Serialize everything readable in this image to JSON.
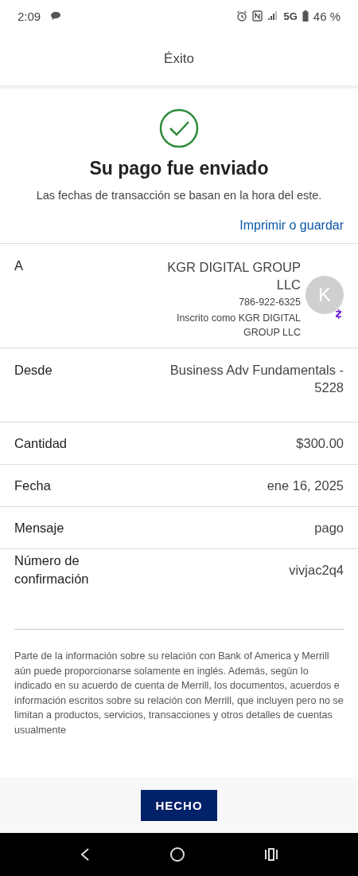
{
  "status_bar": {
    "time": "2:09",
    "network": "5G",
    "battery": "46 %"
  },
  "header": {
    "title": "Éxito"
  },
  "confirmation": {
    "title": "Su pago fue enviado",
    "subtitle": "Las fechas de transacción se basan en la hora del este.",
    "print_link": "Imprimir o guardar"
  },
  "recipient": {
    "label": "A",
    "name": "KGR DIGITAL GROUP LLC",
    "phone": "786-922-6325",
    "enrolled": "Inscrito como KGR DIGITAL GROUP LLC",
    "avatar_initial": "K"
  },
  "details": [
    {
      "label": "Desde",
      "value": "Business Adv Fundamentals - 5228"
    },
    {
      "label": "Cantidad",
      "value": "$300.00"
    },
    {
      "label": "Fecha",
      "value": "ene 16, 2025"
    },
    {
      "label": "Mensaje",
      "value": "pago"
    },
    {
      "label": "Número de confirmación",
      "value": "vivjac2q4"
    }
  ],
  "disclaimer": "Parte de la información sobre su relación con Bank of America y Merrill aún puede proporcionarse solamente en inglés. Además, según lo indicado en su acuerdo de cuenta de Merrill, los documentos, acuerdos e información escritos sobre su relación con Merrill, que incluyen pero no se limitan a productos, servicios, transacciones y otros detalles de cuentas usualmente",
  "done_button": "HECHO"
}
